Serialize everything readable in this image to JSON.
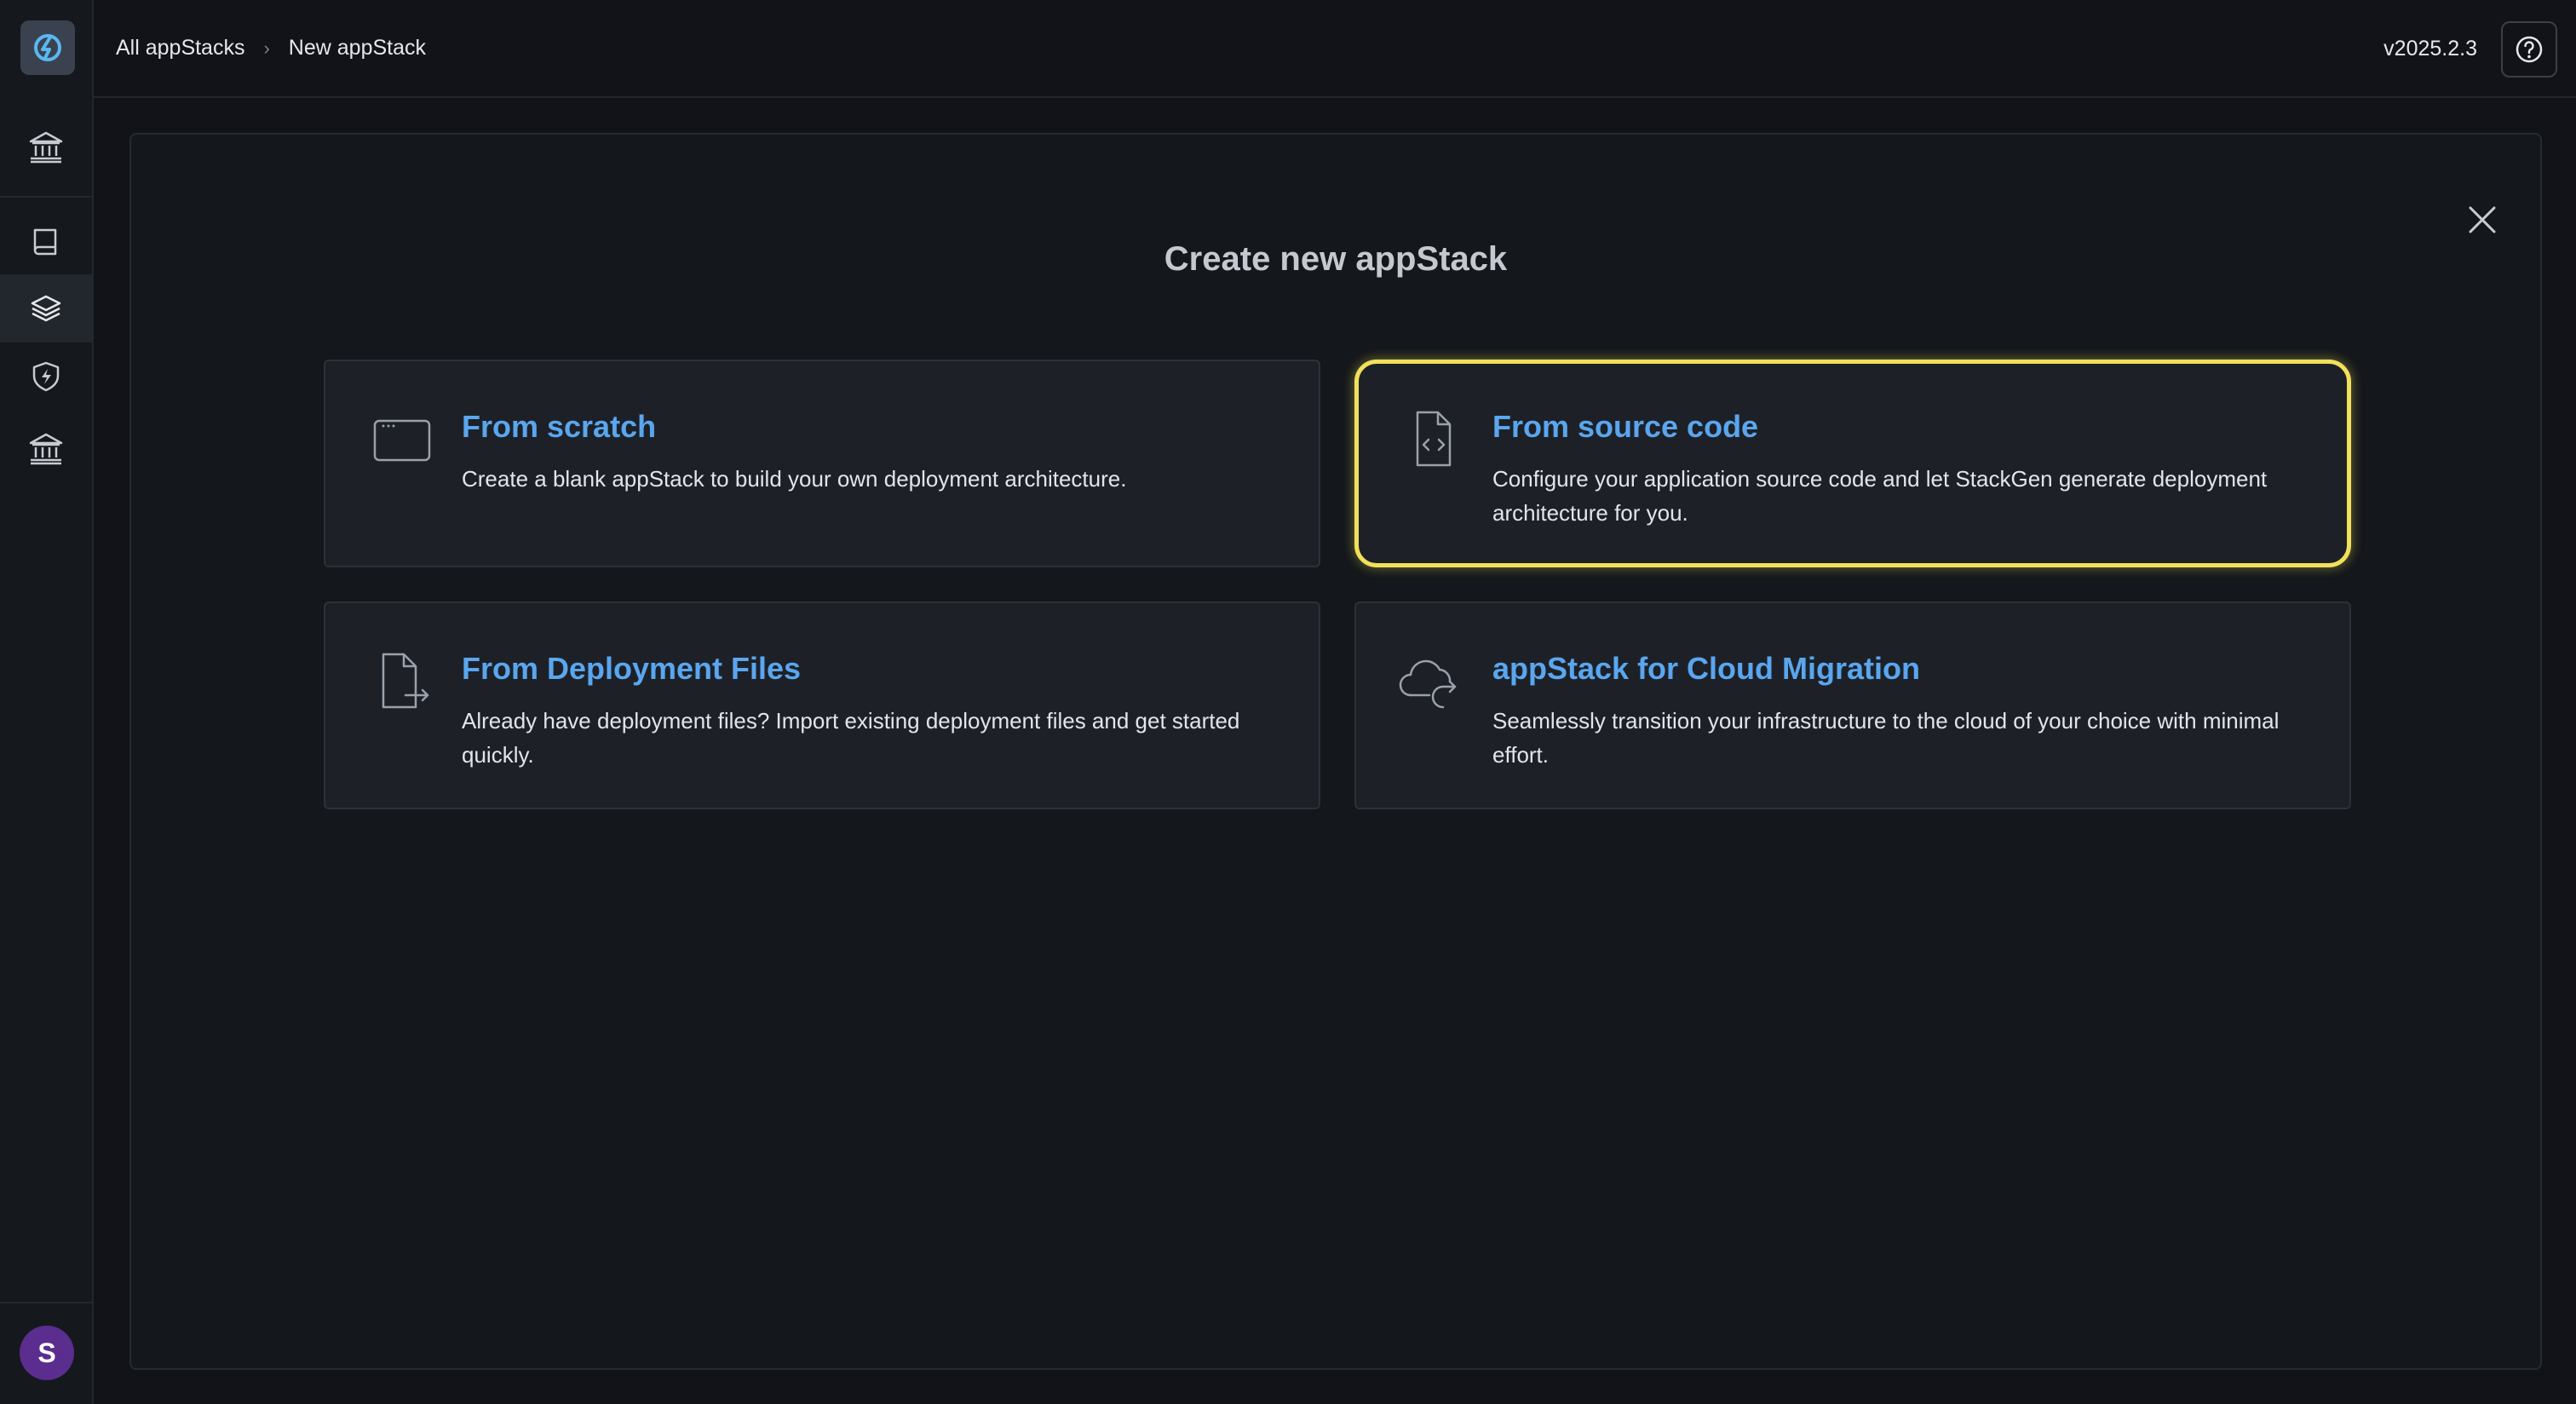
{
  "header": {
    "breadcrumb": {
      "root": "All appStacks",
      "current": "New appStack"
    },
    "version": "v2025.2.3"
  },
  "sidebar": {
    "items": [
      {
        "icon": "bank-icon"
      },
      {
        "icon": "book-icon"
      },
      {
        "icon": "layers-icon",
        "active": true
      },
      {
        "icon": "shield-bolt-icon"
      },
      {
        "icon": "bank-icon"
      }
    ],
    "avatar_initial": "S"
  },
  "main": {
    "title": "Create new appStack",
    "options": [
      {
        "title": "From scratch",
        "description": "Create a blank appStack to build your own deployment architecture.",
        "icon": "window-icon"
      },
      {
        "title": "From source code",
        "description": "Configure your application source code and let StackGen generate deployment architecture for you.",
        "icon": "code-file-icon"
      },
      {
        "title": "From Deployment Files",
        "description": "Already have deployment files? Import existing deployment files and get started quickly.",
        "icon": "file-import-icon"
      },
      {
        "title": "appStack for Cloud Migration",
        "description": "Seamlessly transition your infrastructure to the cloud of your choice with minimal effort.",
        "icon": "cloud-migrate-icon"
      }
    ]
  },
  "colors": {
    "background": "#111318",
    "card": "#1d2127",
    "accent_text": "#5aa6ef",
    "highlight": "#f1e05a",
    "avatar": "#5b2d8e"
  }
}
